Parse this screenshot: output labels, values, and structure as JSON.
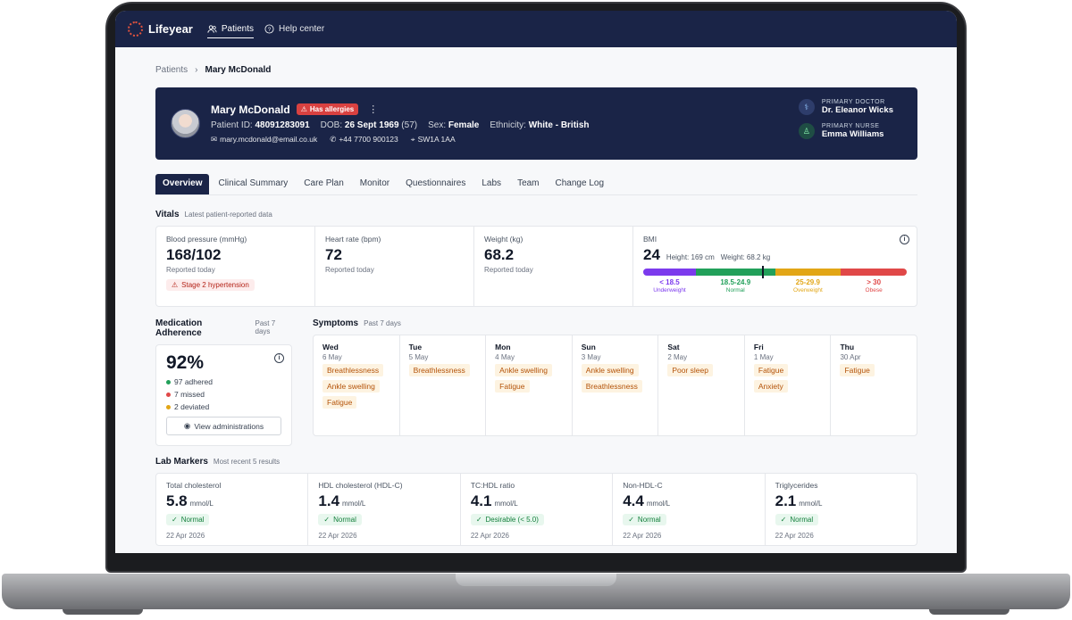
{
  "app": {
    "name": "Lifeyear"
  },
  "nav": {
    "patients": "Patients",
    "help": "Help center"
  },
  "breadcrumb": {
    "parent": "Patients",
    "current": "Mary McDonald"
  },
  "patient": {
    "name": "Mary McDonald",
    "allergy_badge": "Has allergies",
    "id_label": "Patient ID:",
    "id": "48091283091",
    "dob_label": "DOB:",
    "dob": "26 Sept 1969",
    "age": "(57)",
    "sex_label": "Sex:",
    "sex": "Female",
    "ethnicity_label": "Ethnicity:",
    "ethnicity": "White - British",
    "email": "mary.mcdonald@email.co.uk",
    "phone": "+44 7700 900123",
    "postcode": "SW1A 1AA",
    "doctor_role": "PRIMARY DOCTOR",
    "doctor": "Dr. Eleanor Wicks",
    "nurse_role": "PRIMARY NURSE",
    "nurse": "Emma Williams"
  },
  "tabs": [
    "Overview",
    "Clinical Summary",
    "Care Plan",
    "Monitor",
    "Questionnaires",
    "Labs",
    "Team",
    "Change Log"
  ],
  "vitals": {
    "title": "Vitals",
    "subtitle": "Latest patient-reported data",
    "bp": {
      "label": "Blood pressure (mmHg)",
      "value": "168/102",
      "sub": "Reported today",
      "alert": "Stage 2 hypertension"
    },
    "hr": {
      "label": "Heart rate (bpm)",
      "value": "72",
      "sub": "Reported today"
    },
    "weight": {
      "label": "Weight (kg)",
      "value": "68.2",
      "sub": "Reported today"
    },
    "bmi": {
      "label": "BMI",
      "value": "24",
      "height": "Height: 169 cm",
      "weight": "Weight: 68.2 kg",
      "ranges": [
        {
          "range": "< 18.5",
          "name": "Underweight",
          "color": "#7c3aed"
        },
        {
          "range": "18.5-24.9",
          "name": "Normal",
          "color": "#22a05a"
        },
        {
          "range": "25-29.9",
          "name": "Overweight",
          "color": "#e2a616"
        },
        {
          "range": "> 30",
          "name": "Obese",
          "color": "#e04848"
        }
      ]
    }
  },
  "adherence": {
    "title": "Medication Adherence",
    "subtitle": "Past 7 days",
    "value": "92%",
    "adhered": "97 adhered",
    "missed": "7 missed",
    "deviated": "2 deviated",
    "button": "View administrations"
  },
  "symptoms": {
    "title": "Symptoms",
    "subtitle": "Past 7 days",
    "days": [
      {
        "day": "Wed",
        "date": "6 May",
        "items": [
          "Breathlessness",
          "Ankle swelling",
          "Fatigue"
        ]
      },
      {
        "day": "Tue",
        "date": "5 May",
        "items": [
          "Breathlessness"
        ]
      },
      {
        "day": "Mon",
        "date": "4 May",
        "items": [
          "Ankle swelling",
          "Fatigue"
        ]
      },
      {
        "day": "Sun",
        "date": "3 May",
        "items": [
          "Ankle swelling",
          "Breathlessness"
        ]
      },
      {
        "day": "Sat",
        "date": "2 May",
        "items": [
          "Poor sleep"
        ]
      },
      {
        "day": "Fri",
        "date": "1 May",
        "items": [
          "Fatigue",
          "Anxiety"
        ]
      },
      {
        "day": "Thu",
        "date": "30 Apr",
        "items": [
          "Fatigue"
        ]
      }
    ]
  },
  "labs": {
    "title": "Lab Markers",
    "subtitle": "Most recent 5 results",
    "items": [
      {
        "name": "Total cholesterol",
        "value": "5.8",
        "unit": "mmol/L",
        "status": "Normal",
        "date": "22 Apr 2026"
      },
      {
        "name": "HDL cholesterol (HDL-C)",
        "value": "1.4",
        "unit": "mmol/L",
        "status": "Normal",
        "date": "22 Apr 2026"
      },
      {
        "name": "TC:HDL ratio",
        "value": "4.1",
        "unit": "mmol/L",
        "status": "Desirable (< 5.0)",
        "date": "22 Apr 2026"
      },
      {
        "name": "Non-HDL-C",
        "value": "4.4",
        "unit": "mmol/L",
        "status": "Normal",
        "date": "22 Apr 2026"
      },
      {
        "name": "Triglycerides",
        "value": "2.1",
        "unit": "mmol/L",
        "status": "Normal",
        "date": "22 Apr 2026"
      }
    ]
  }
}
